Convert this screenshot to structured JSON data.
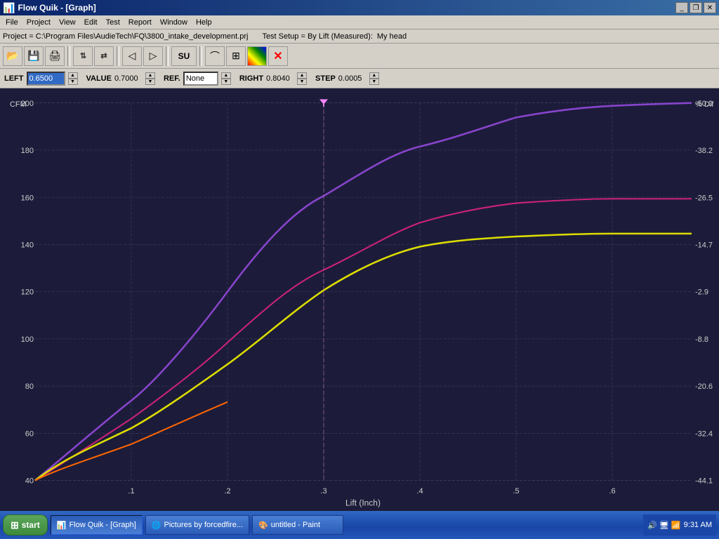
{
  "window": {
    "title": "Flow Quik - [Graph]"
  },
  "titlebar_buttons": {
    "minimize": "_",
    "restore": "❐",
    "close": "✕"
  },
  "menubar": {
    "items": [
      "File",
      "Project",
      "View",
      "Edit",
      "Test",
      "Report",
      "Window",
      "Help"
    ]
  },
  "projectbar": {
    "label": "Project = C:\\Program Files\\AudieTech\\FQ\\3800_intake_development.prj",
    "test_setup": "Test Setup = By Lift (Measured):",
    "head": "My head"
  },
  "controls": {
    "left_label": "LEFT",
    "left_value": "0.6500",
    "value_label": "VALUE",
    "value_value": "0.7000",
    "ref_label": "REF.",
    "ref_value": "None",
    "right_label": "RIGHT",
    "right_value": "0.8040",
    "step_label": "STEP",
    "step_value": "0.0005"
  },
  "graph": {
    "x_label": "Lift (Inch)",
    "y_left_label": "CFM",
    "y_right_label": "% Dif",
    "x_ticks": [
      ".1",
      ".2",
      ".3",
      ".4",
      ".5",
      ".6"
    ],
    "y_left_ticks": [
      "40",
      "60",
      "80",
      "100",
      "120",
      "140",
      "160",
      "180",
      "200"
    ],
    "y_right_ticks": [
      "-44.1",
      "-32.4",
      "-20.6",
      "-8.8",
      "-2.9",
      "-14.7",
      "-26.5",
      "-38.2",
      "-50.0"
    ],
    "marker_x": "0.3",
    "accent_color": "#316ac5"
  },
  "taskbar": {
    "start_label": "start",
    "items": [
      {
        "label": "Flow Quik - [Graph]",
        "active": true,
        "icon": "chart-icon"
      },
      {
        "label": "Pictures by forcedfire...",
        "active": false,
        "icon": "browser-icon"
      },
      {
        "label": "untitled - Paint",
        "active": false,
        "icon": "paint-icon"
      }
    ],
    "time": "9:31 AM"
  },
  "toolbar_buttons": [
    {
      "name": "open-folder",
      "icon": "📂"
    },
    {
      "name": "save",
      "icon": "💾"
    },
    {
      "name": "print",
      "icon": "🖨"
    },
    {
      "name": "flow-up",
      "icon": "⬆"
    },
    {
      "name": "flow-down",
      "icon": "⬇"
    },
    {
      "name": "tool1",
      "icon": "◀"
    },
    {
      "name": "tool2",
      "icon": "▶"
    },
    {
      "name": "su-tool",
      "icon": "SU"
    },
    {
      "name": "curve",
      "icon": "∿"
    },
    {
      "name": "bar",
      "icon": "▦"
    },
    {
      "name": "color",
      "icon": "🎨"
    },
    {
      "name": "close-graph",
      "icon": "✕"
    }
  ]
}
